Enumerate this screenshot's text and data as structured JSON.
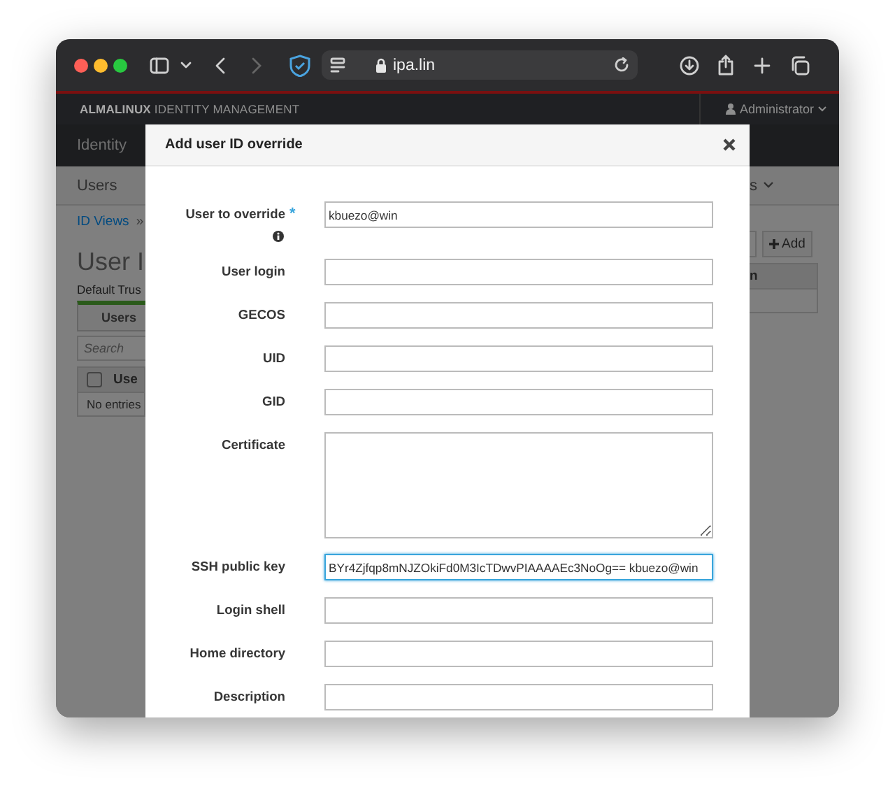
{
  "browser": {
    "url": "ipa.lin"
  },
  "masthead": {
    "brand": "**ALMALINUX** IDENTITY MANAGEMENT",
    "user": "Administrator"
  },
  "nav": {
    "label": "Identity"
  },
  "subnav": {
    "left": "Users",
    "right": "s"
  },
  "background_page": {
    "breadcrumb": "ID Views",
    "breadcrumb_separator": "»",
    "title": "User I",
    "subtitle": "Default Trus",
    "tabs": [
      {
        "label": "Users",
        "selected": true
      }
    ],
    "search": {
      "placeholder": "Search"
    },
    "add_button": "Add",
    "columns": [
      "Use",
      "n"
    ],
    "select_all_checked": false,
    "empty_message": "No entries"
  },
  "dialog": {
    "title": "Add user ID override",
    "required_mark": "*",
    "fields": [
      {
        "label": "User to override",
        "kind": "input",
        "required": true,
        "info": true,
        "focused": false,
        "value": "kbuezo@win"
      },
      {
        "label": "User login",
        "kind": "input",
        "required": false,
        "info": false,
        "focused": false
      },
      {
        "label": "GECOS",
        "kind": "input",
        "required": false,
        "info": false,
        "focused": false
      },
      {
        "label": "UID",
        "kind": "input",
        "required": false,
        "info": false,
        "focused": false
      },
      {
        "label": "GID",
        "kind": "input",
        "required": false,
        "info": false,
        "focused": false
      },
      {
        "label": "Certificate",
        "kind": "textarea",
        "required": false,
        "info": false,
        "focused": false
      },
      {
        "label": "SSH public key",
        "kind": "input",
        "required": false,
        "info": false,
        "focused": true,
        "value": "BYr4Zjfqp8mNJZOkiFd0M3IcTDwvPIAAAAEc3NoOg== kbuezo@win"
      },
      {
        "label": "Login shell",
        "kind": "input",
        "required": false,
        "info": false,
        "focused": false
      },
      {
        "label": "Home directory",
        "kind": "input",
        "required": false,
        "info": false,
        "focused": false
      },
      {
        "label": "Description",
        "kind": "input",
        "required": false,
        "info": false,
        "focused": false
      }
    ]
  }
}
